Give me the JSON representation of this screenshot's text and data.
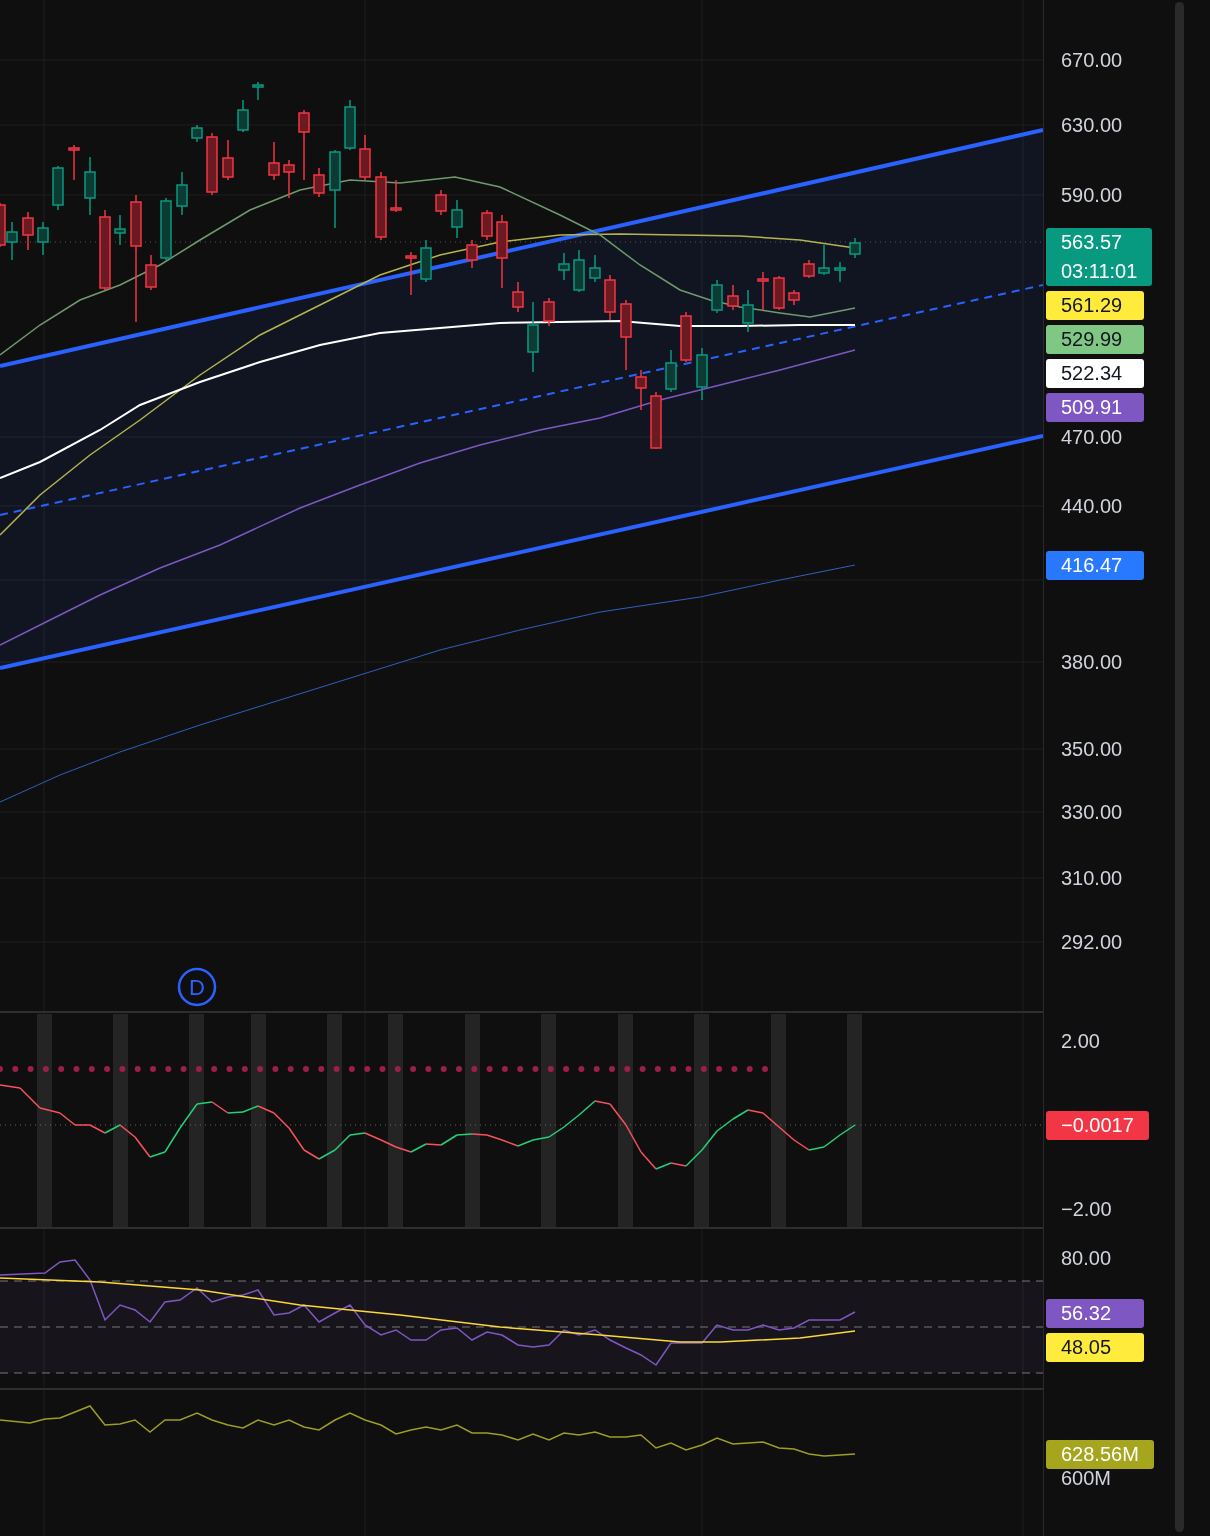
{
  "main_pane": {
    "ticks": [
      "670.00",
      "630.00",
      "590.00",
      "470.00",
      "440.00",
      "380.00",
      "350.00",
      "330.00",
      "310.00",
      "292.00"
    ],
    "price_labels": [
      {
        "value": "563.57",
        "countdown": "03:11:01",
        "color": "#089981"
      },
      {
        "value": "561.29",
        "color": "#ffeb3b"
      },
      {
        "value": "529.99",
        "color": "#81c784"
      },
      {
        "value": "522.34",
        "color": "#ffffff"
      },
      {
        "value": "509.91",
        "color": "#7e57c2"
      },
      {
        "value": "416.47",
        "color": "#2979ff"
      }
    ],
    "event_marker": {
      "letter": "D"
    }
  },
  "oscillator_pane": {
    "ticks": [
      "2.00",
      "−2.00"
    ],
    "price_labels": [
      {
        "value": "−0.0017",
        "color": "#f23645"
      }
    ]
  },
  "rsi_pane": {
    "ticks": [
      "80.00"
    ],
    "price_labels": [
      {
        "value": "56.32",
        "color": "#7e57c2"
      },
      {
        "value": "48.05",
        "color": "#ffeb3b"
      }
    ]
  },
  "volume_pane": {
    "ticks": [
      "600M"
    ],
    "price_labels": [
      {
        "value": "628.56M",
        "color": "#a5a51e"
      }
    ]
  }
}
